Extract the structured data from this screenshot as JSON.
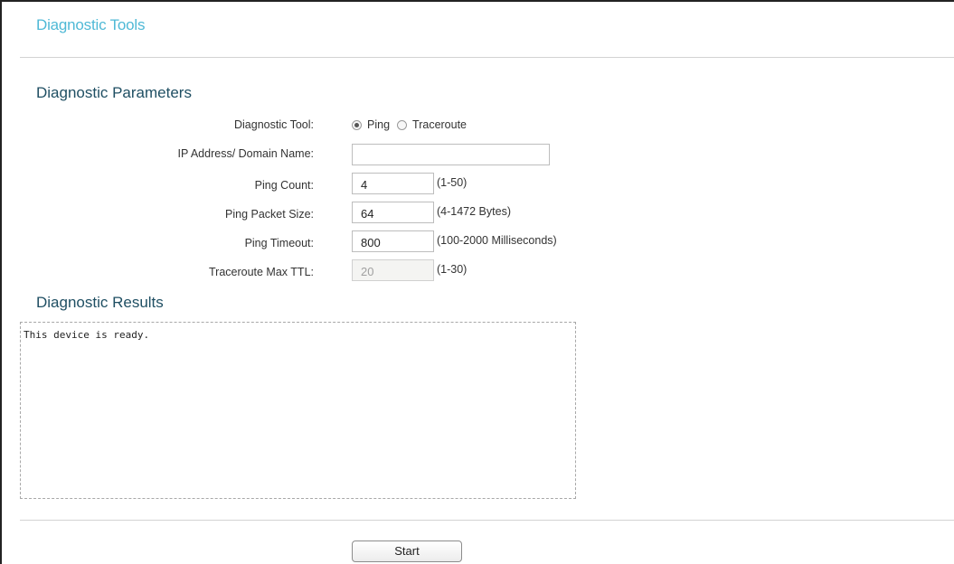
{
  "page": {
    "title": "Diagnostic Tools"
  },
  "parameters": {
    "section_title": "Diagnostic Parameters",
    "diagnostic_tool": {
      "label": "Diagnostic Tool:",
      "options": [
        {
          "label": "Ping",
          "checked": true
        },
        {
          "label": "Traceroute",
          "checked": false
        }
      ]
    },
    "ip_address": {
      "label": "IP Address/ Domain Name:",
      "value": ""
    },
    "ping_count": {
      "label": "Ping Count:",
      "value": "4",
      "hint": "(1-50)"
    },
    "ping_packet_size": {
      "label": "Ping Packet Size:",
      "value": "64",
      "hint": "(4-1472 Bytes)"
    },
    "ping_timeout": {
      "label": "Ping Timeout:",
      "value": "800",
      "hint": "(100-2000 Milliseconds)"
    },
    "traceroute_max_ttl": {
      "label": "Traceroute Max TTL:",
      "value": "20",
      "hint": "(1-30)",
      "disabled": true
    }
  },
  "results": {
    "section_title": "Diagnostic Results",
    "text": "This device is ready."
  },
  "actions": {
    "start_label": "Start"
  },
  "colors": {
    "title": "#4fb9d6",
    "section_title": "#1f4f63"
  }
}
